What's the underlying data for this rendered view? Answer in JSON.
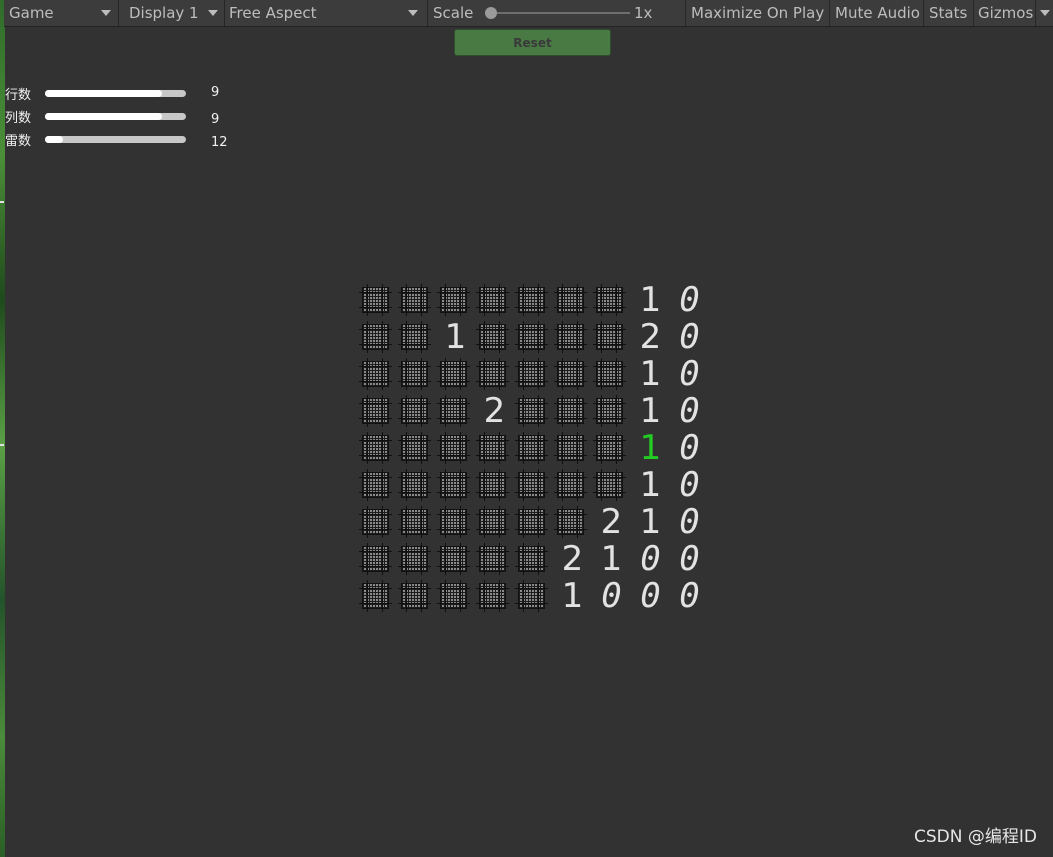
{
  "toolbar": {
    "game_label": "Game",
    "display_label": "Display 1",
    "aspect_label": "Free Aspect",
    "scale_label": "Scale",
    "scale_value": "1x",
    "maximize_label": "Maximize On Play",
    "mute_label": "Mute Audio",
    "stats_label": "Stats",
    "gizmos_label": "Gizmos"
  },
  "reset_button": {
    "label": "Reset",
    "color": "#4a7a44"
  },
  "settings": {
    "rows": {
      "label": "行数",
      "value": "9",
      "fill_fraction": 0.83
    },
    "cols": {
      "label": "列数",
      "value": "9",
      "fill_fraction": 0.83
    },
    "mines": {
      "label": "雷数",
      "value": "12",
      "fill_fraction": 0.13
    }
  },
  "board": {
    "cells": [
      [
        "#",
        "#",
        "#",
        "#",
        "#",
        "#",
        "#",
        "1",
        "0"
      ],
      [
        "#",
        "#",
        "1",
        "#",
        "#",
        "#",
        "#",
        "2",
        "0"
      ],
      [
        "#",
        "#",
        "#",
        "#",
        "#",
        "#",
        "#",
        "1",
        "0"
      ],
      [
        "#",
        "#",
        "#",
        "2",
        "#",
        "#",
        "#",
        "1",
        "0"
      ],
      [
        "#",
        "#",
        "#",
        "#",
        "#",
        "#",
        "#",
        "1*",
        "0"
      ],
      [
        "#",
        "#",
        "#",
        "#",
        "#",
        "#",
        "#",
        "1",
        "0"
      ],
      [
        "#",
        "#",
        "#",
        "#",
        "#",
        "#",
        "2",
        "1",
        "0"
      ],
      [
        "#",
        "#",
        "#",
        "#",
        "#",
        "2",
        "1",
        "0",
        "0"
      ],
      [
        "#",
        "#",
        "#",
        "#",
        "#",
        "1",
        "0",
        "0",
        "0"
      ]
    ],
    "highlight_color": "#22cc22",
    "number_color": "#e2e2e2"
  },
  "watermark": "CSDN @编程ID"
}
